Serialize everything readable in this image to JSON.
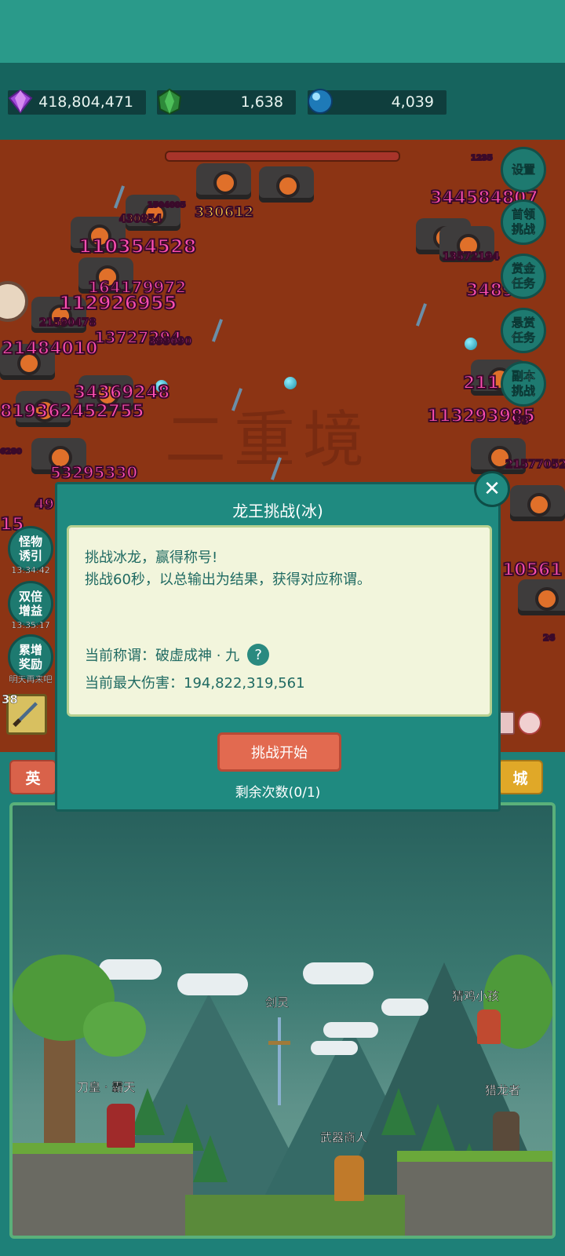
{
  "resources": [
    {
      "icon": "purple-gem-icon",
      "value": "418,804,471"
    },
    {
      "icon": "green-gem-icon",
      "value": "1,638"
    },
    {
      "icon": "blue-orb-icon",
      "value": "4,039"
    }
  ],
  "battle": {
    "background_text": "二重境",
    "damage_numbers": [
      "344584807",
      "1235",
      "330612",
      "430854",
      "1504005",
      "110354528",
      "13572194",
      "164179972",
      "112926955",
      "3489",
      "21590478",
      "13727294",
      "399090",
      "21484010",
      "211",
      "34369248",
      "113293985",
      "819362452755",
      "33",
      "6280",
      "53295330",
      "21577052",
      "49",
      "15",
      "10561",
      "26"
    ]
  },
  "right_menu": [
    {
      "id": "settings",
      "label": "设置"
    },
    {
      "id": "boss-challenge",
      "label": "首领\n挑战"
    },
    {
      "id": "bounty-task",
      "label": "赏金\n任务"
    },
    {
      "id": "reward-task",
      "label": "悬赏\n任务"
    },
    {
      "id": "dungeon-challenge",
      "label": "副本\n挑战"
    }
  ],
  "left_menu": [
    {
      "id": "monster-lure",
      "label": "怪物\n诱引",
      "timer": "13:34:42"
    },
    {
      "id": "double-gain",
      "label": "双倍\n增益",
      "timer": "13:35:17"
    },
    {
      "id": "cumulative-reward",
      "label": "累增\n奖励",
      "timer": "明天再来吧"
    }
  ],
  "item_slot": {
    "level": "38"
  },
  "tabs": {
    "left": "英",
    "right": "城"
  },
  "scene": {
    "npcs": [
      "剑灵",
      "猜鸡小孩",
      "刀皇 · 霸天",
      "猎龙者",
      "武器商人"
    ]
  },
  "modal": {
    "title": "龙王挑战(冰)",
    "line1": "挑战冰龙，赢得称号!",
    "line2": "挑战60秒，以总输出为结果，获得对应称谓。",
    "current_title_label": "当前称谓：",
    "current_title_value": "破虚成神 · 九",
    "help_glyph": "?",
    "max_damage_label": "当前最大伤害：",
    "max_damage_value": "194,822,319,561",
    "start_button": "挑战开始",
    "remaining": "剩余次数(0/1)",
    "close_glyph": "✕"
  },
  "colors": {
    "accent": "#1f8a80",
    "battle_bg": "#8c3414",
    "damage_pink": "#ff4fb4",
    "start_button": "#e26a50",
    "panel_bg": "#f2f5dc"
  }
}
